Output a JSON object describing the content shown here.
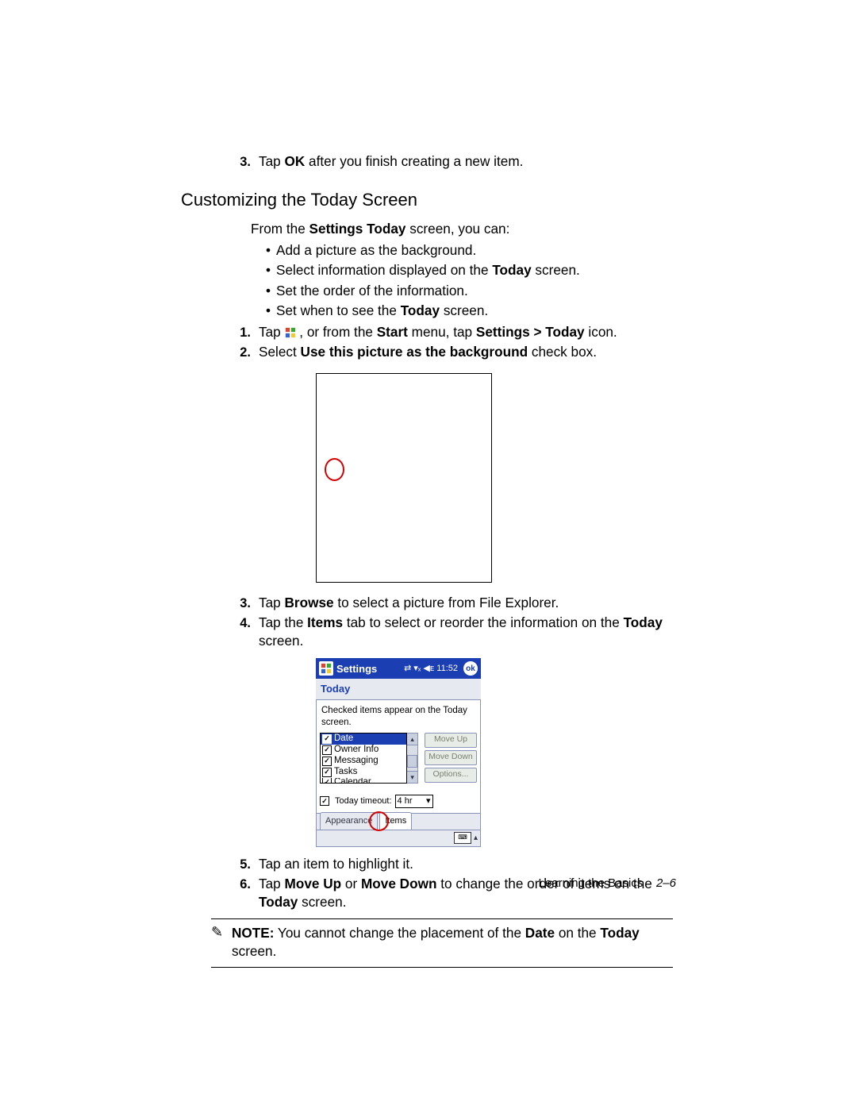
{
  "top_step": {
    "num": "3.",
    "pre": "Tap ",
    "bold": "OK",
    "post": " after you finish creating a new item."
  },
  "heading": "Customizing the Today Screen",
  "intro": {
    "pre": "From the ",
    "bold": "Settings Today",
    "post": " screen, you can:"
  },
  "bullets": [
    {
      "text": "Add a picture as the background."
    },
    {
      "pre": "Select information displayed on the ",
      "bold": "Today",
      "post": " screen."
    },
    {
      "text": "Set the order of the information."
    },
    {
      "pre": "Set when to see the ",
      "bold": "Today",
      "post": " screen."
    }
  ],
  "steps_a": [
    {
      "num": "1.",
      "pre": "Tap ",
      "mid": ", or from the ",
      "b1": "Start",
      "mid2": " menu, tap ",
      "b2": "Settings > Today",
      "post": " icon."
    },
    {
      "num": "2.",
      "pre": "Select ",
      "b1": "Use this picture as the background",
      "post": " check box."
    }
  ],
  "steps_b": [
    {
      "num": "3.",
      "pre": "Tap ",
      "b1": "Browse",
      "post": " to select a picture from File Explorer."
    },
    {
      "num": "4.",
      "pre": "Tap the ",
      "b1": "Items",
      "mid": " tab to select or reorder the information on the ",
      "b2": "Today",
      "post": " screen."
    }
  ],
  "steps_c": [
    {
      "num": "5.",
      "text": "Tap an item to highlight it."
    },
    {
      "num": "6.",
      "pre": "Tap ",
      "b1": "Move Up",
      "mid": " or ",
      "b2": "Move Down",
      "mid2": " to change the order of items on the ",
      "b3": "Today",
      "post": " screen."
    }
  ],
  "note": {
    "label": "NOTE:",
    "pre": "  You cannot change the placement of the ",
    "b1": "Date",
    "mid": " on the ",
    "b2": "Today",
    "post": " screen."
  },
  "device": {
    "titlebar": {
      "app": "Settings",
      "time": "11:52",
      "ok": "ok"
    },
    "subtitle": "Today",
    "hint": "Checked items appear on the Today screen.",
    "list": [
      {
        "label": "Date",
        "checked": true,
        "selected": true
      },
      {
        "label": "Owner Info",
        "checked": true
      },
      {
        "label": "Messaging",
        "checked": true
      },
      {
        "label": "Tasks",
        "checked": true
      },
      {
        "label": "Calendar",
        "checked": true
      }
    ],
    "buttons": {
      "up": "Move Up",
      "down": "Move Down",
      "opt": "Options..."
    },
    "timeout": {
      "label": "Today timeout:",
      "value": "4 hr"
    },
    "tabs": {
      "appearance": "Appearance",
      "items": "Items"
    }
  },
  "footer": {
    "section": "Learning the Basics",
    "page": "2–6"
  }
}
